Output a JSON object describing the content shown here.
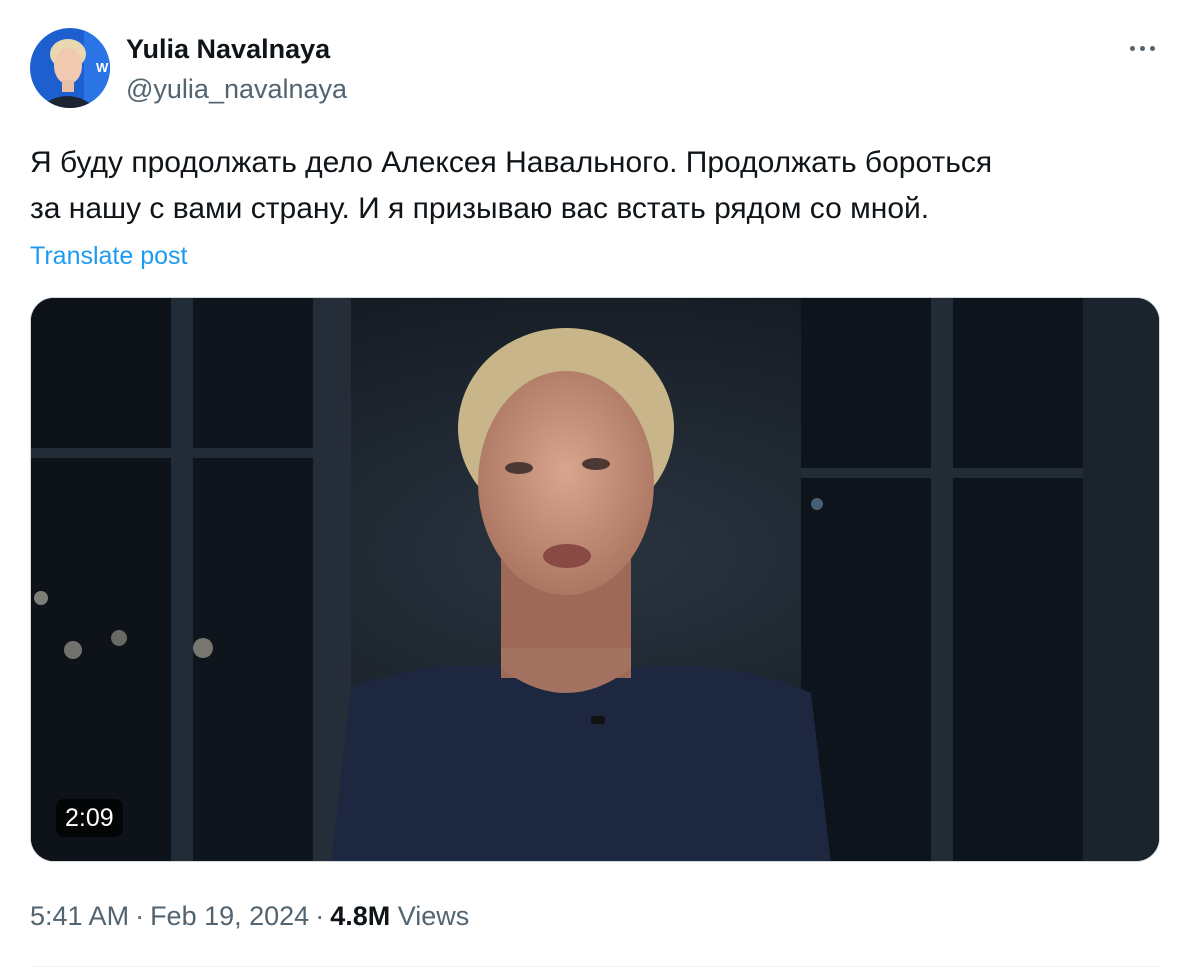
{
  "author": {
    "name": "Yulia Navalnaya",
    "handle": "@yulia_navalnaya"
  },
  "post": {
    "text": "Я буду продолжать дело Алексея Навального. Продолжать бороться\nза нашу с вами страну. И я призываю вас встать рядом со мной.",
    "translate_label": "Translate post"
  },
  "media": {
    "type": "video",
    "duration": "2:09"
  },
  "meta": {
    "time": "5:41 AM",
    "date": "Feb 19, 2024",
    "separator": "·",
    "views_count": "4.8M",
    "views_label": "Views"
  },
  "icons": {
    "more": "more-horizontal-icon"
  },
  "colors": {
    "link": "#1d9bf0",
    "text_primary": "#0f1419",
    "text_secondary": "#536471"
  }
}
